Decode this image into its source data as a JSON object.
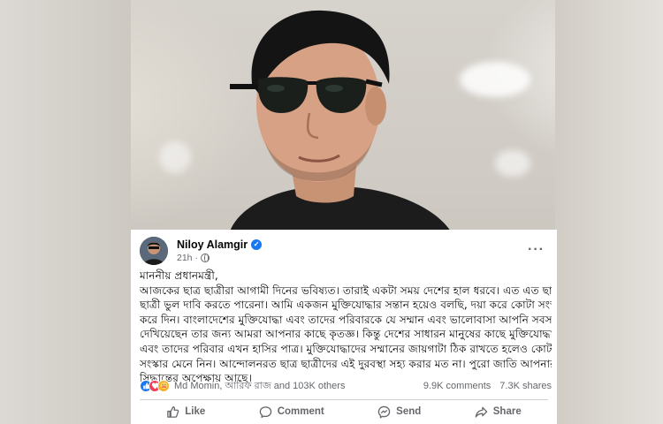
{
  "post": {
    "author": "Niloy Alamgir",
    "time": "21h",
    "time_sep": "·",
    "more_label": "···",
    "verified_mark": "✓",
    "body_lines": [
      "মাননীয় প্রধানমন্ত্রী,",
      "আজকের ছাত্র ছাত্রীরা আগামী দিনের ভবিষ্যত। তারাই একটা সময় দেশের হাল ধরবে। এত এত ছাত্র",
      "ছাত্রী ভুল দাবি করতে পারেনা। আমি একজন মুক্তিযোদ্ধার সন্তান হয়েও বলছি, দয়া করে কোটা সংস্কার",
      "করে দিন। বাংলাদেশের মুক্তিযোদ্ধা এবং তাদের পরিবারকে যে সম্মান এবং ভালোবাসা আপনি সবসময়",
      "দেখিয়েছেন তার জন্য আমরা আপনার কাছে কৃতজ্ঞ। কিন্তু দেশের সাধারন মানুষের কাছে মুক্তিযোদ্ধা",
      "এবং তাদের পরিবার এখন হাসির পাত্র। মুক্তিযোদ্ধাদের সম্মানের জায়গাটা ঠিক রাখতে হলেও কোটা",
      "সংস্কার মেনে নিন। আন্দোলনরত ছাত্র ছাত্রীদের এই দুরবস্থা সহ্য করার মত না। পুরো জাতি আপনার",
      "সিদ্ধান্তের অপেক্ষায় আছে।"
    ],
    "reactions_text": "Md Momin, আরিফ রাজ and 103K others",
    "comments": "9.9K comments",
    "shares": "7.3K shares",
    "actions": {
      "like": "Like",
      "comment": "Comment",
      "send": "Send",
      "share": "Share"
    }
  },
  "colors": {
    "facebook_blue": "#1877f2",
    "text_primary": "#050505",
    "text_secondary": "#65676b",
    "love_red": "#f33e58",
    "care_yellow": "#f7b125"
  },
  "icons": [
    "globe-icon",
    "verified-badge-icon",
    "like-reaction-icon",
    "love-reaction-icon",
    "care-reaction-icon",
    "like-icon",
    "comment-icon",
    "send-icon",
    "share-icon",
    "more-options-icon"
  ]
}
